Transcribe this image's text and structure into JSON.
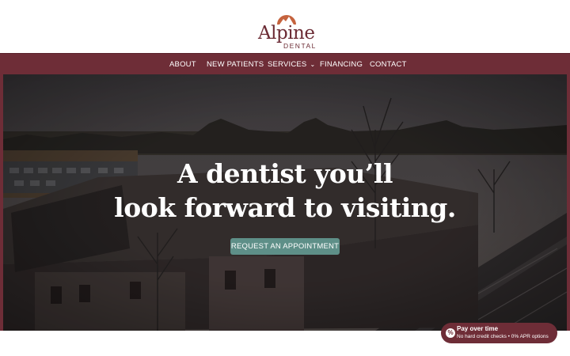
{
  "brand": {
    "name": "Alpine",
    "subtitle": "DENTAL"
  },
  "nav": {
    "items": [
      {
        "label": "ABOUT"
      },
      {
        "label": "NEW PATIENTS"
      },
      {
        "label": "SERVICES"
      },
      {
        "label": "FINANCING"
      },
      {
        "label": "CONTACT"
      }
    ]
  },
  "hero": {
    "title_line1": "A dentist you’ll",
    "title_line2": "look forward to visiting.",
    "cta_label": "REQUEST AN APPOINTMENT"
  },
  "financing_badge": {
    "title": "Pay over time",
    "subtitle": "No hard credit checks • 0% APR options",
    "icon_glyph": "%"
  },
  "colors": {
    "brand_maroon": "#6e2d37",
    "logo_orange": "#c5633e",
    "cta_teal": "#5e8f88"
  },
  "icons": [
    "mountain-sun-logo-icon",
    "chevron-down-icon",
    "percent-icon"
  ]
}
